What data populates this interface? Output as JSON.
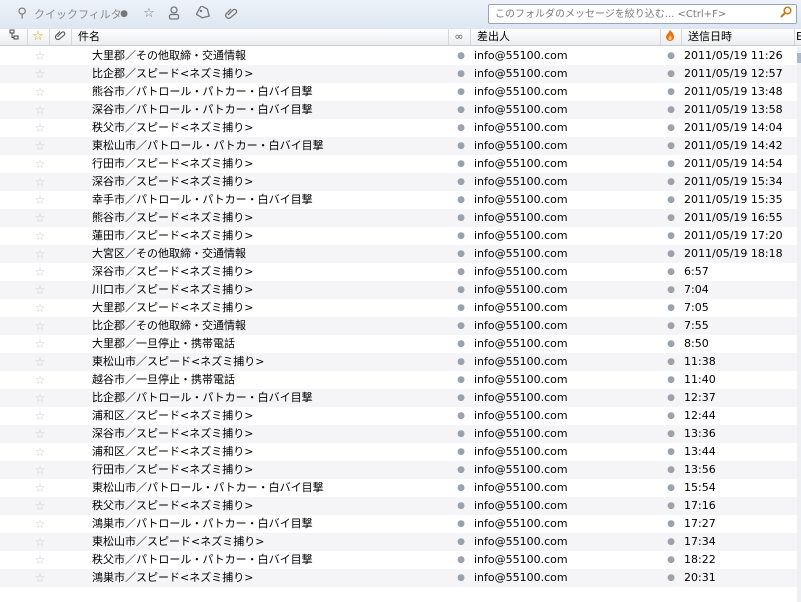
{
  "toolbar": {
    "quick_filter_label": "クイックフィルタ",
    "icons": [
      "quick-filter-icon",
      "unread-filter-icon",
      "starred-filter-icon",
      "contact-filter-icon",
      "tags-filter-icon",
      "attachment-filter-icon"
    ],
    "search_placeholder": "このフォルダのメッセージを絞り込む... <Ctrl+F>"
  },
  "columns": {
    "thread_icon": "thread-icon",
    "star_icon": "star-icon",
    "attachment_icon": "attachment-icon",
    "subject": "件名",
    "read_icon": "read-status-icon",
    "from": "差出人",
    "junk_icon": "junk-status-icon",
    "date": "送信日時",
    "extra": "E"
  },
  "messages": [
    {
      "subject": "大里郡／その他取締・交通情報",
      "from": "info@55100.com",
      "date": "2011/05/19 11:26"
    },
    {
      "subject": "比企郡／スピード<ネズミ捕り>",
      "from": "info@55100.com",
      "date": "2011/05/19 12:57"
    },
    {
      "subject": "熊谷市／パトロール・パトカー・白バイ目撃",
      "from": "info@55100.com",
      "date": "2011/05/19 13:48"
    },
    {
      "subject": "深谷市／パトロール・パトカー・白バイ目撃",
      "from": "info@55100.com",
      "date": "2011/05/19 13:58"
    },
    {
      "subject": "秩父市／スピード<ネズミ捕り>",
      "from": "info@55100.com",
      "date": "2011/05/19 14:04"
    },
    {
      "subject": "東松山市／パトロール・パトカー・白バイ目撃",
      "from": "info@55100.com",
      "date": "2011/05/19 14:42"
    },
    {
      "subject": "行田市／スピード<ネズミ捕り>",
      "from": "info@55100.com",
      "date": "2011/05/19 14:54"
    },
    {
      "subject": "深谷市／スピード<ネズミ捕り>",
      "from": "info@55100.com",
      "date": "2011/05/19 15:34"
    },
    {
      "subject": "幸手市／パトロール・パトカー・白バイ目撃",
      "from": "info@55100.com",
      "date": "2011/05/19 15:35"
    },
    {
      "subject": "熊谷市／スピード<ネズミ捕り>",
      "from": "info@55100.com",
      "date": "2011/05/19 16:55"
    },
    {
      "subject": "蓮田市／スピード<ネズミ捕り>",
      "from": "info@55100.com",
      "date": "2011/05/19 17:20"
    },
    {
      "subject": "大宮区／その他取締・交通情報",
      "from": "info@55100.com",
      "date": "2011/05/19 18:18"
    },
    {
      "subject": "深谷市／スピード<ネズミ捕り>",
      "from": "info@55100.com",
      "date": "6:57"
    },
    {
      "subject": "川口市／スピード<ネズミ捕り>",
      "from": "info@55100.com",
      "date": "7:04"
    },
    {
      "subject": "大里郡／スピード<ネズミ捕り>",
      "from": "info@55100.com",
      "date": "7:05"
    },
    {
      "subject": "比企郡／その他取締・交通情報",
      "from": "info@55100.com",
      "date": "7:55"
    },
    {
      "subject": "大里郡／一旦停止・携帯電話",
      "from": "info@55100.com",
      "date": "8:50"
    },
    {
      "subject": "東松山市／スピード<ネズミ捕り>",
      "from": "info@55100.com",
      "date": "11:38"
    },
    {
      "subject": "越谷市／一旦停止・携帯電話",
      "from": "info@55100.com",
      "date": "11:40"
    },
    {
      "subject": "比企郡／パトロール・パトカー・白バイ目撃",
      "from": "info@55100.com",
      "date": "12:37"
    },
    {
      "subject": "浦和区／スピード<ネズミ捕り>",
      "from": "info@55100.com",
      "date": "12:44"
    },
    {
      "subject": "深谷市／スピード<ネズミ捕り>",
      "from": "info@55100.com",
      "date": "13:36"
    },
    {
      "subject": "浦和区／スピード<ネズミ捕り>",
      "from": "info@55100.com",
      "date": "13:44"
    },
    {
      "subject": "行田市／スピード<ネズミ捕り>",
      "from": "info@55100.com",
      "date": "13:56"
    },
    {
      "subject": "東松山市／パトロール・パトカー・白バイ目撃",
      "from": "info@55100.com",
      "date": "15:54"
    },
    {
      "subject": "秩父市／スピード<ネズミ捕り>",
      "from": "info@55100.com",
      "date": "17:16"
    },
    {
      "subject": "鴻巣市／パトロール・パトカー・白バイ目撃",
      "from": "info@55100.com",
      "date": "17:27"
    },
    {
      "subject": "東松山市／スピード<ネズミ捕り>",
      "from": "info@55100.com",
      "date": "17:34"
    },
    {
      "subject": "秩父市／パトロール・パトカー・白バイ目撃",
      "from": "info@55100.com",
      "date": "18:22"
    },
    {
      "subject": "鴻巣市／スピード<ネズミ捕り>",
      "from": "info@55100.com",
      "date": "20:31"
    }
  ]
}
